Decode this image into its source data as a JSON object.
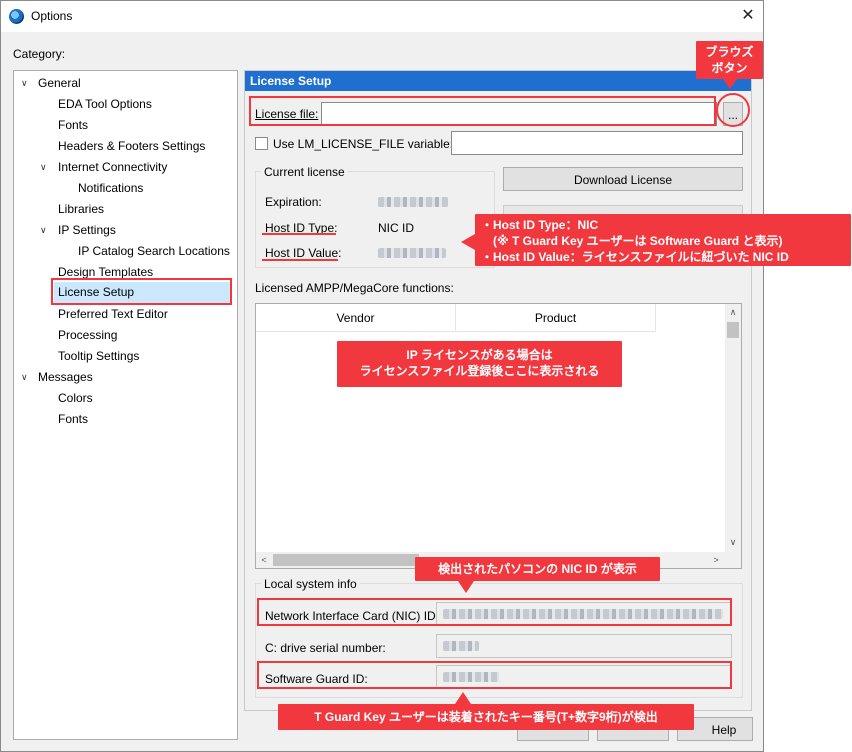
{
  "window": {
    "title": "Options"
  },
  "category_label": "Category:",
  "tree": [
    {
      "label": "General",
      "expanded": true
    },
    {
      "label": "EDA Tool Options"
    },
    {
      "label": "Fonts"
    },
    {
      "label": "Headers & Footers Settings"
    },
    {
      "label": "Internet Connectivity",
      "expanded": true
    },
    {
      "label": "Notifications"
    },
    {
      "label": "Libraries"
    },
    {
      "label": "IP Settings",
      "expanded": true
    },
    {
      "label": "IP Catalog Search Locations"
    },
    {
      "label": "Design Templates"
    },
    {
      "label": "License Setup",
      "selected": true
    },
    {
      "label": "Preferred Text Editor"
    },
    {
      "label": "Processing"
    },
    {
      "label": "Tooltip Settings"
    },
    {
      "label": "Messages",
      "expanded": true
    },
    {
      "label": "Colors"
    },
    {
      "label": "Fonts"
    }
  ],
  "panel": {
    "title": "License Setup",
    "license_file_label": "License file:",
    "license_file_value": "",
    "browse_button": "...",
    "use_lm_label": "Use LM_LICENSE_FILE variable:",
    "use_lm_checked": false,
    "use_lm_value": "",
    "current_license_title": "Current license",
    "expiration_label": "Expiration:",
    "host_id_type_label": "Host ID Type:",
    "host_id_type_value": "NIC ID",
    "host_id_value_label": "Host ID Value:",
    "download_license_button": "Download License",
    "licensed_functions_label": "Licensed AMPP/MegaCore functions:",
    "table_columns": [
      "Vendor",
      "Product"
    ],
    "local_info_title": "Local system info",
    "nic_label": "Network Interface Card (NIC) ID:",
    "drive_serial_label": "C: drive serial number:",
    "software_guard_label": "Software Guard ID:"
  },
  "footer": {
    "help_button": "Help"
  },
  "annotations": {
    "browse_note": [
      "ブラウズ",
      "ボタン"
    ],
    "host_id_note": [
      "・Host ID Type：NIC",
      "　(※ T Guard Key ユーザーは Software Guard と表示)",
      "・Host ID Value：ライセンスファイルに紐づいた NIC ID"
    ],
    "ip_note": [
      "IP ライセンスがある場合は",
      "ライセンスファイル登録後ここに表示される"
    ],
    "nic_note": "検出されたパソコンの NIC ID が表示",
    "guard_note": "T Guard Key ユーザーは装着されたキー番号(T+数字9桁)が検出"
  },
  "colors": {
    "accent": "#1e6fd0",
    "annotation": "#f2383f",
    "selection": "#cce8ff"
  }
}
